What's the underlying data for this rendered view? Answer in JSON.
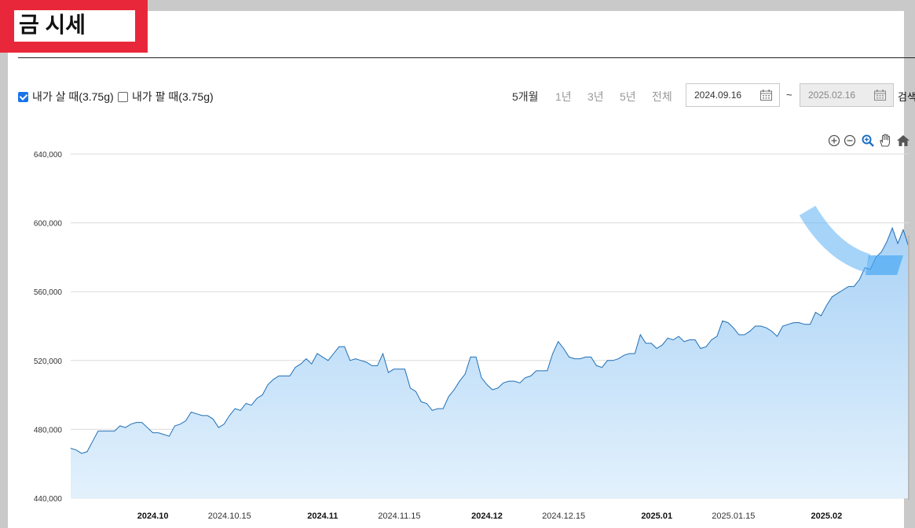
{
  "page": {
    "title": "금 시세"
  },
  "options": [
    {
      "label": "내가 살 때(3.75g)",
      "checked": true
    },
    {
      "label": "내가 팔 때(3.75g)",
      "checked": false
    }
  ],
  "periods": [
    {
      "label": "5개월",
      "active": true
    },
    {
      "label": "1년",
      "active": false
    },
    {
      "label": "3년",
      "active": false
    },
    {
      "label": "5년",
      "active": false
    },
    {
      "label": "전체",
      "active": false
    }
  ],
  "date_range": {
    "from": "2024.09.16",
    "to": "2025.02.16",
    "separator": "~"
  },
  "search_label": "검색",
  "toolbar_icons": [
    "zoom-in-icon",
    "zoom-out-icon",
    "magnify-icon",
    "pan-hand-icon",
    "home-icon"
  ],
  "colors": {
    "line": "#1f6fb5",
    "fill_top": "#a9d2f6",
    "fill_bottom": "#e3f1fc",
    "highlight": "#e8283a",
    "annotation": "#6bb7f5"
  },
  "chart_data": {
    "type": "area",
    "title": "",
    "xlabel": "",
    "ylabel": "",
    "ylim": [
      440000,
      640000
    ],
    "yticks": [
      440000,
      480000,
      520000,
      560000,
      600000,
      640000
    ],
    "ytick_labels": [
      "440,000",
      "480,000",
      "520,000",
      "560,000",
      "600,000",
      "640,000"
    ],
    "xlim": [
      "2024-09-16",
      "2025-02-16"
    ],
    "xticks": [
      {
        "date": "2024-10-01",
        "label": "2024.10",
        "major": true
      },
      {
        "date": "2024-10-15",
        "label": "2024.10.15",
        "major": false
      },
      {
        "date": "2024-11-01",
        "label": "2024.11",
        "major": true
      },
      {
        "date": "2024-11-15",
        "label": "2024.11.15",
        "major": false
      },
      {
        "date": "2024-12-01",
        "label": "2024.12",
        "major": true
      },
      {
        "date": "2024-12-15",
        "label": "2024.12.15",
        "major": false
      },
      {
        "date": "2025-01-01",
        "label": "2025.01",
        "major": true
      },
      {
        "date": "2025-01-15",
        "label": "2025.01.15",
        "major": false
      },
      {
        "date": "2025-02-01",
        "label": "2025.02",
        "major": true
      }
    ],
    "grid": true,
    "series": [
      {
        "name": "내가 살 때(3.75g)",
        "points": [
          [
            "2024-09-16",
            469000
          ],
          [
            "2024-09-17",
            468000
          ],
          [
            "2024-09-18",
            466000
          ],
          [
            "2024-09-19",
            467000
          ],
          [
            "2024-09-20",
            473000
          ],
          [
            "2024-09-21",
            479000
          ],
          [
            "2024-09-23",
            479000
          ],
          [
            "2024-09-24",
            479000
          ],
          [
            "2024-09-25",
            482000
          ],
          [
            "2024-09-26",
            481000
          ],
          [
            "2024-09-27",
            483000
          ],
          [
            "2024-09-28",
            484000
          ],
          [
            "2024-09-29",
            484000
          ],
          [
            "2024-09-30",
            481000
          ],
          [
            "2024-10-01",
            478000
          ],
          [
            "2024-10-02",
            478000
          ],
          [
            "2024-10-03",
            477000
          ],
          [
            "2024-10-04",
            476000
          ],
          [
            "2024-10-05",
            482000
          ],
          [
            "2024-10-06",
            483000
          ],
          [
            "2024-10-07",
            485000
          ],
          [
            "2024-10-08",
            490000
          ],
          [
            "2024-10-09",
            489000
          ],
          [
            "2024-10-10",
            488000
          ],
          [
            "2024-10-11",
            488000
          ],
          [
            "2024-10-12",
            486000
          ],
          [
            "2024-10-13",
            481000
          ],
          [
            "2024-10-14",
            483000
          ],
          [
            "2024-10-15",
            488000
          ],
          [
            "2024-10-16",
            492000
          ],
          [
            "2024-10-17",
            491000
          ],
          [
            "2024-10-18",
            495000
          ],
          [
            "2024-10-19",
            494000
          ],
          [
            "2024-10-20",
            498000
          ],
          [
            "2024-10-21",
            500000
          ],
          [
            "2024-10-22",
            506000
          ],
          [
            "2024-10-23",
            509000
          ],
          [
            "2024-10-24",
            511000
          ],
          [
            "2024-10-26",
            511000
          ],
          [
            "2024-10-27",
            516000
          ],
          [
            "2024-10-28",
            518000
          ],
          [
            "2024-10-29",
            521000
          ],
          [
            "2024-10-30",
            518000
          ],
          [
            "2024-10-31",
            524000
          ],
          [
            "2024-11-01",
            522000
          ],
          [
            "2024-11-02",
            520000
          ],
          [
            "2024-11-03",
            524000
          ],
          [
            "2024-11-04",
            528000
          ],
          [
            "2024-11-05",
            528000
          ],
          [
            "2024-11-06",
            520000
          ],
          [
            "2024-11-07",
            521000
          ],
          [
            "2024-11-08",
            520000
          ],
          [
            "2024-11-09",
            519000
          ],
          [
            "2024-11-10",
            517000
          ],
          [
            "2024-11-11",
            517000
          ],
          [
            "2024-11-12",
            524000
          ],
          [
            "2024-11-13",
            513000
          ],
          [
            "2024-11-14",
            515000
          ],
          [
            "2024-11-15",
            515000
          ],
          [
            "2024-11-16",
            515000
          ],
          [
            "2024-11-17",
            504000
          ],
          [
            "2024-11-18",
            502000
          ],
          [
            "2024-11-19",
            496000
          ],
          [
            "2024-11-20",
            495000
          ],
          [
            "2024-11-21",
            491000
          ],
          [
            "2024-11-22",
            492000
          ],
          [
            "2024-11-23",
            492000
          ],
          [
            "2024-11-24",
            499000
          ],
          [
            "2024-11-25",
            503000
          ],
          [
            "2024-11-26",
            508000
          ],
          [
            "2024-11-27",
            512000
          ],
          [
            "2024-11-28",
            522000
          ],
          [
            "2024-11-29",
            522000
          ],
          [
            "2024-11-30",
            510000
          ],
          [
            "2024-12-01",
            506000
          ],
          [
            "2024-12-02",
            503000
          ],
          [
            "2024-12-03",
            504000
          ],
          [
            "2024-12-04",
            507000
          ],
          [
            "2024-12-05",
            508000
          ],
          [
            "2024-12-06",
            508000
          ],
          [
            "2024-12-07",
            507000
          ],
          [
            "2024-12-08",
            510000
          ],
          [
            "2024-12-09",
            511000
          ],
          [
            "2024-12-10",
            514000
          ],
          [
            "2024-12-11",
            514000
          ],
          [
            "2024-12-12",
            514000
          ],
          [
            "2024-12-13",
            524000
          ],
          [
            "2024-12-14",
            531000
          ],
          [
            "2024-12-15",
            527000
          ],
          [
            "2024-12-16",
            522000
          ],
          [
            "2024-12-17",
            521000
          ],
          [
            "2024-12-18",
            521000
          ],
          [
            "2024-12-19",
            522000
          ],
          [
            "2024-12-20",
            522000
          ],
          [
            "2024-12-21",
            517000
          ],
          [
            "2024-12-22",
            516000
          ],
          [
            "2024-12-23",
            520000
          ],
          [
            "2024-12-24",
            520000
          ],
          [
            "2024-12-25",
            521000
          ],
          [
            "2024-12-26",
            523000
          ],
          [
            "2024-12-27",
            524000
          ],
          [
            "2024-12-28",
            524000
          ],
          [
            "2024-12-29",
            535000
          ],
          [
            "2024-12-30",
            530000
          ],
          [
            "2024-12-31",
            530000
          ],
          [
            "2025-01-01",
            527000
          ],
          [
            "2025-01-02",
            529000
          ],
          [
            "2025-01-03",
            533000
          ],
          [
            "2025-01-04",
            532000
          ],
          [
            "2025-01-05",
            534000
          ],
          [
            "2025-01-06",
            531000
          ],
          [
            "2025-01-07",
            532000
          ],
          [
            "2025-01-08",
            532000
          ],
          [
            "2025-01-09",
            527000
          ],
          [
            "2025-01-10",
            528000
          ],
          [
            "2025-01-11",
            532000
          ],
          [
            "2025-01-12",
            534000
          ],
          [
            "2025-01-13",
            543000
          ],
          [
            "2025-01-14",
            542000
          ],
          [
            "2025-01-15",
            539000
          ],
          [
            "2025-01-16",
            535000
          ],
          [
            "2025-01-17",
            535000
          ],
          [
            "2025-01-18",
            537000
          ],
          [
            "2025-01-19",
            540000
          ],
          [
            "2025-01-20",
            540000
          ],
          [
            "2025-01-21",
            539000
          ],
          [
            "2025-01-22",
            537000
          ],
          [
            "2025-01-23",
            534000
          ],
          [
            "2025-01-24",
            540000
          ],
          [
            "2025-01-25",
            541000
          ],
          [
            "2025-01-26",
            542000
          ],
          [
            "2025-01-27",
            542000
          ],
          [
            "2025-01-28",
            541000
          ],
          [
            "2025-01-29",
            541000
          ],
          [
            "2025-01-30",
            548000
          ],
          [
            "2025-01-31",
            546000
          ],
          [
            "2025-02-01",
            552000
          ],
          [
            "2025-02-02",
            557000
          ],
          [
            "2025-02-03",
            559000
          ],
          [
            "2025-02-04",
            561000
          ],
          [
            "2025-02-05",
            563000
          ],
          [
            "2025-02-06",
            563000
          ],
          [
            "2025-02-07",
            567000
          ],
          [
            "2025-02-08",
            574000
          ],
          [
            "2025-02-09",
            573000
          ],
          [
            "2025-02-10",
            580000
          ],
          [
            "2025-02-11",
            583000
          ],
          [
            "2025-02-12",
            589000
          ],
          [
            "2025-02-13",
            597000
          ],
          [
            "2025-02-14",
            588000
          ],
          [
            "2025-02-15",
            596000
          ],
          [
            "2025-02-16",
            586000
          ]
        ]
      }
    ]
  }
}
